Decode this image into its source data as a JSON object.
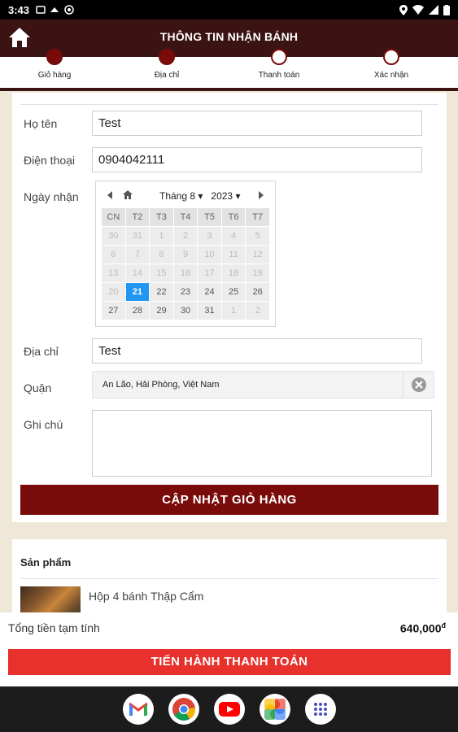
{
  "status_bar": {
    "time": "3:43"
  },
  "app_bar": {
    "title": "THÔNG TIN NHẬN BÁNH"
  },
  "steps": [
    {
      "label": "Giỏ hàng",
      "done": true
    },
    {
      "label": "Địa chỉ",
      "done": true
    },
    {
      "label": "Thanh toán",
      "done": false
    },
    {
      "label": "Xác nhận",
      "done": false
    }
  ],
  "form": {
    "name_label": "Họ tên",
    "name_value": "Test",
    "phone_label": "Điện thoại",
    "phone_value": "0904042111",
    "date_label": "Ngày nhận",
    "address_label": "Địa chỉ",
    "address_value": "Test",
    "district_label": "Quận",
    "district_value": "An Lão, Hải Phòng, Việt Nam",
    "note_label": "Ghi chú",
    "note_value": "",
    "update_button": "CẬP NHẬT GIỎ HÀNG"
  },
  "calendar": {
    "month": "Tháng 8",
    "year": "2023",
    "weekdays": [
      "CN",
      "T2",
      "T3",
      "T4",
      "T5",
      "T6",
      "T7"
    ],
    "weeks": [
      [
        "30",
        "31",
        "1",
        "2",
        "3",
        "4",
        "5"
      ],
      [
        "6",
        "7",
        "8",
        "9",
        "10",
        "11",
        "12"
      ],
      [
        "13",
        "14",
        "15",
        "16",
        "17",
        "18",
        "19"
      ],
      [
        "20",
        "21",
        "22",
        "23",
        "24",
        "25",
        "26"
      ],
      [
        "27",
        "28",
        "29",
        "30",
        "31",
        "1",
        "2"
      ]
    ],
    "selected": "21"
  },
  "products": {
    "title": "Sản phẩm",
    "items": [
      {
        "name": "Hộp 4 bánh Thập Cẩm"
      }
    ]
  },
  "totals": {
    "label": "Tổng tiền tạm tính",
    "value": "640,000",
    "currency": "đ"
  },
  "checkout_button": "TIẾN HÀNH THANH TOÁN",
  "colors": {
    "primary_dark": "#3b1313",
    "accent": "#7a0b0b",
    "checkout": "#e8302c",
    "selected_date": "#2196f3"
  },
  "dock_apps": [
    "gmail-icon",
    "chrome-icon",
    "youtube-icon",
    "photos-icon",
    "app-drawer-icon"
  ]
}
